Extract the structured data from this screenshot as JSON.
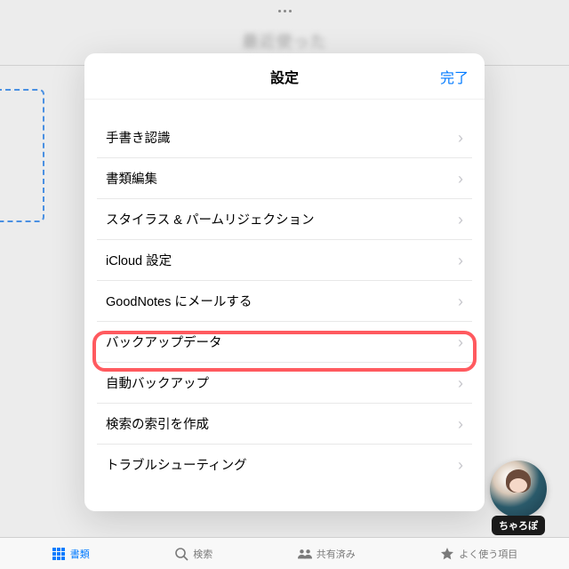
{
  "background": {
    "blurred_title": "最近使った"
  },
  "modal": {
    "title": "設定",
    "done_label": "完了",
    "rows": [
      {
        "label": "手書き認識"
      },
      {
        "label": "書類編集"
      },
      {
        "label": "スタイラス & パームリジェクション"
      },
      {
        "label": "iCloud 設定"
      },
      {
        "label": "GoodNotes にメールする"
      },
      {
        "label": "バックアップデータ"
      },
      {
        "label": "自動バックアップ"
      },
      {
        "label": "検索の索引を作成"
      },
      {
        "label": "トラブルシューティング"
      }
    ],
    "highlighted_index": 6
  },
  "tabs": [
    {
      "label": "書類",
      "icon": "grid"
    },
    {
      "label": "検索",
      "icon": "search"
    },
    {
      "label": "共有済み",
      "icon": "people"
    },
    {
      "label": "よく使う項目",
      "icon": "star"
    }
  ],
  "active_tab_index": 0,
  "avatar": {
    "name": "ちゃろぽ"
  }
}
